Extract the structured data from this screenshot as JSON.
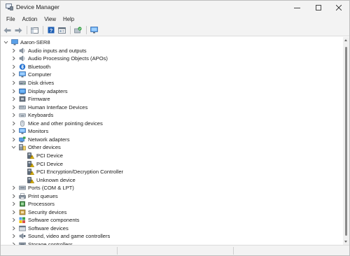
{
  "window": {
    "title": "Device Manager"
  },
  "menu": [
    {
      "label": "File"
    },
    {
      "label": "Action"
    },
    {
      "label": "View"
    },
    {
      "label": "Help"
    }
  ],
  "toolbar": {
    "buttons": [
      "back-icon",
      "forward-icon",
      "show-hide-console-tree-icon",
      "help-icon",
      "properties-icon",
      "update-driver-icon",
      "scan-hardware-changes-icon"
    ]
  },
  "tree": {
    "root": "Aaron-SER8",
    "items": [
      {
        "label": "Audio inputs and outputs",
        "icon": "speaker-icon",
        "expanded": false
      },
      {
        "label": "Audio Processing Objects (APOs)",
        "icon": "speaker-icon",
        "expanded": false
      },
      {
        "label": "Bluetooth",
        "icon": "bluetooth-icon",
        "expanded": false
      },
      {
        "label": "Computer",
        "icon": "computer-icon",
        "expanded": false
      },
      {
        "label": "Disk drives",
        "icon": "disk-drive-icon",
        "expanded": false
      },
      {
        "label": "Display adapters",
        "icon": "display-adapter-icon",
        "expanded": false
      },
      {
        "label": "Firmware",
        "icon": "firmware-icon",
        "expanded": false
      },
      {
        "label": "Human Interface Devices",
        "icon": "hid-icon",
        "expanded": false
      },
      {
        "label": "Keyboards",
        "icon": "keyboard-icon",
        "expanded": false
      },
      {
        "label": "Mice and other pointing devices",
        "icon": "mouse-icon",
        "expanded": false
      },
      {
        "label": "Monitors",
        "icon": "monitor-icon",
        "expanded": false
      },
      {
        "label": "Network adapters",
        "icon": "network-adapter-icon",
        "expanded": false
      },
      {
        "label": "Other devices",
        "icon": "other-devices-icon",
        "expanded": true,
        "children": [
          {
            "label": "PCI Device",
            "icon": "unknown-device-warning-icon"
          },
          {
            "label": "PCI Device",
            "icon": "unknown-device-warning-icon"
          },
          {
            "label": "PCI Encryption/Decryption Controller",
            "icon": "unknown-device-warning-icon"
          },
          {
            "label": "Unknown device",
            "icon": "unknown-device-warning-icon"
          }
        ]
      },
      {
        "label": "Ports (COM & LPT)",
        "icon": "port-icon",
        "expanded": false
      },
      {
        "label": "Print queues",
        "icon": "printer-icon",
        "expanded": false
      },
      {
        "label": "Processors",
        "icon": "processor-icon",
        "expanded": false
      },
      {
        "label": "Security devices",
        "icon": "security-device-icon",
        "expanded": false
      },
      {
        "label": "Software components",
        "icon": "software-component-icon",
        "expanded": false
      },
      {
        "label": "Software devices",
        "icon": "software-device-icon",
        "expanded": false
      },
      {
        "label": "Sound, video and game controllers",
        "icon": "sound-controller-icon",
        "expanded": false
      },
      {
        "label": "Storage controllers",
        "icon": "storage-controller-icon",
        "expanded": false
      }
    ]
  },
  "colors": {
    "accent": "#0078d4",
    "warning": "#f5c400",
    "chrome": "#f3f3f3"
  }
}
